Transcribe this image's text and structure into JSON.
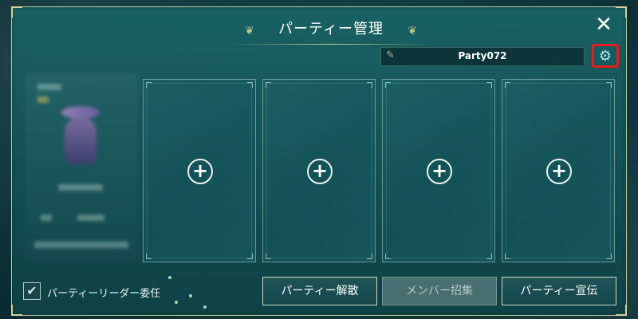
{
  "dialog": {
    "title": "パーティー管理",
    "close_label": "✕"
  },
  "party": {
    "name": "Party072",
    "name_icon": "pencil-icon",
    "settings_icon": "gear-icon",
    "highlight_color": "#e21d1d"
  },
  "slots": [
    {
      "label": "+"
    },
    {
      "label": "+"
    },
    {
      "label": "+"
    },
    {
      "label": "+"
    }
  ],
  "footer": {
    "leader_delegate_label": "パーティーリーダー委任",
    "leader_delegate_checked": true,
    "disband_label": "パーティー解散",
    "recruit_label": "メンバー招集",
    "advertise_label": "パーティー宣伝"
  },
  "colors": {
    "accent": "#c5c992",
    "panel": "#1a6466"
  }
}
